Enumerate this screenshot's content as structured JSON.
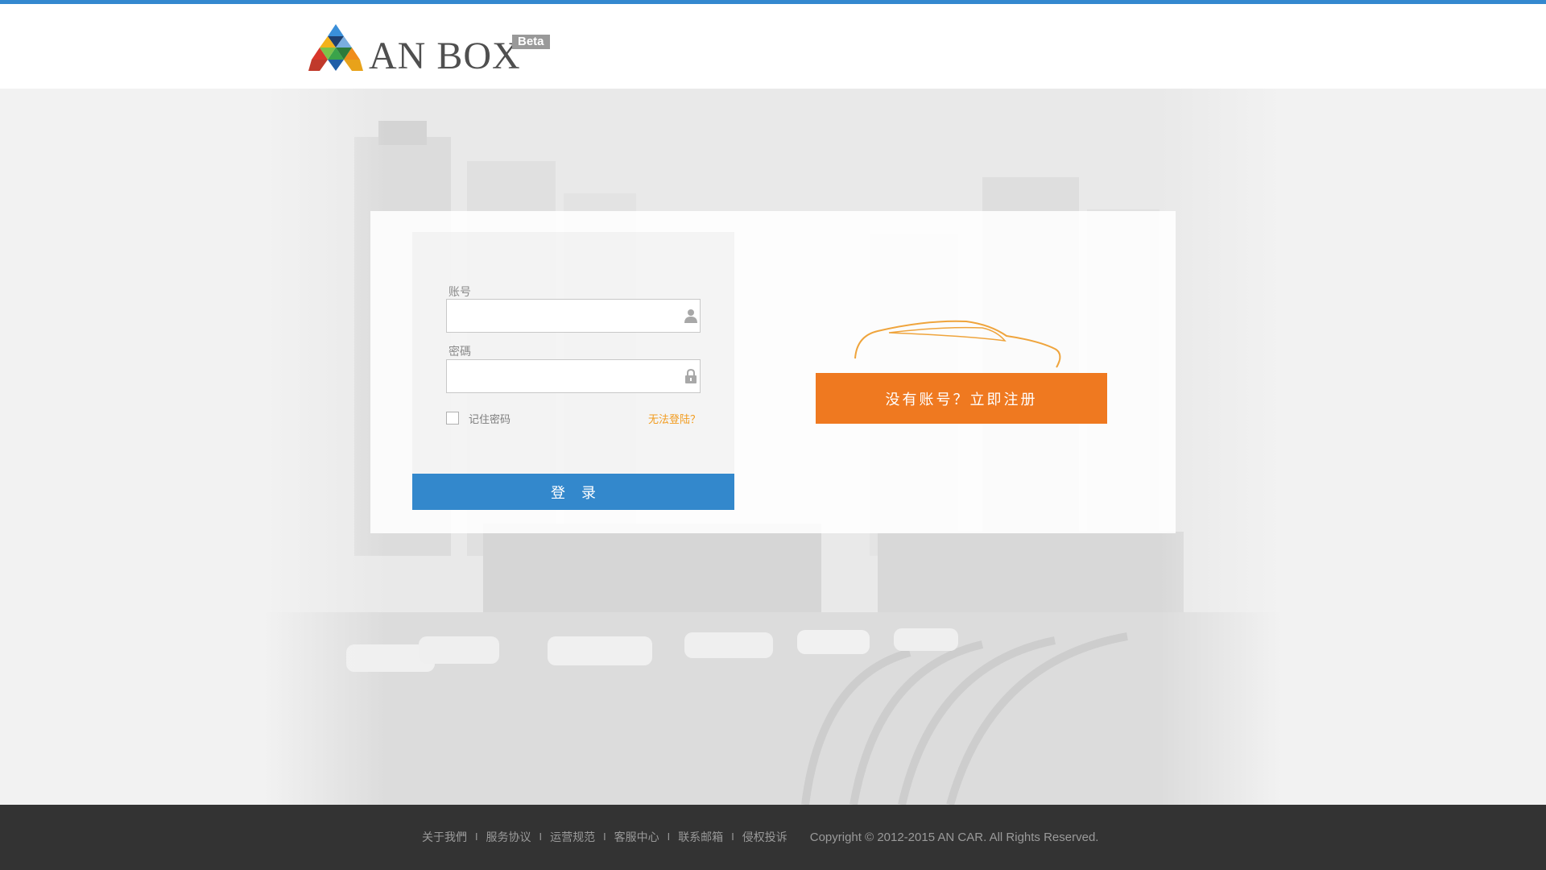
{
  "header": {
    "logo_text": "AN BOX",
    "beta_badge": "Beta",
    "accent_color": "#3488cf"
  },
  "login": {
    "account_label": "账号",
    "account_value": "",
    "account_icon": "user-icon",
    "password_label": "密碼",
    "password_value": "",
    "password_icon": "lock-icon",
    "remember_label": "记住密码",
    "remember_checked": false,
    "forgot_link": "无法登陆？",
    "submit_label": "登录",
    "submit_color": "#3388cc"
  },
  "register": {
    "button_label": "没有账号？立即注册",
    "button_color": "#ef7920",
    "illustration": "car-outline"
  },
  "footer": {
    "links": [
      "关于我們",
      "服务协议",
      "运营规范",
      "客服中心",
      "联系邮箱",
      "侵权投诉"
    ],
    "separator": "I",
    "copyright": "Copyright © 2012-2015 AN CAR.  All Rights Reserved."
  }
}
